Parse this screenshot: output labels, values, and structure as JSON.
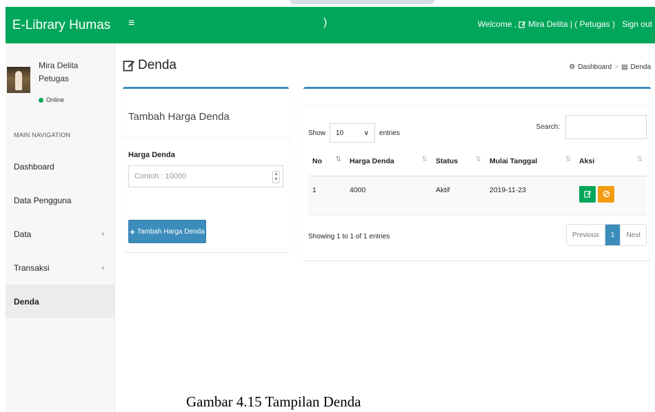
{
  "colors": {
    "header": "#00a65a",
    "primary": "#3c8dbc",
    "success": "#00a65a",
    "warning": "#f39c12"
  },
  "header": {
    "brand": "E-Library Humas",
    "menu_icon": "hamburger-icon",
    "spinner": ")",
    "welcome_prefix": "Welcome ,",
    "welcome_icon": "edit-icon",
    "welcome_text": "Mira Delita | ( Petugas )",
    "signout": "Sign out"
  },
  "sidebar": {
    "user": {
      "name": "Mira Delita",
      "role": "Petugas",
      "status": "Online"
    },
    "nav_header": "MAIN NAVIGATION",
    "items": [
      {
        "label": "Dashboard",
        "chevron": ""
      },
      {
        "label": "Data Pengguna",
        "chevron": ""
      },
      {
        "label": "Data",
        "chevron": "‹"
      },
      {
        "label": "Transaksi",
        "chevron": "‹"
      },
      {
        "label": "Denda",
        "chevron": "",
        "active": true
      }
    ]
  },
  "page": {
    "title": "Denda",
    "title_icon": "edit-icon",
    "breadcrumb": {
      "home": "Dashboard",
      "current": "Denda"
    }
  },
  "form": {
    "title": "Tambah Harga Denda",
    "field_label": "Harga Denda",
    "field_placeholder": "Contoh : 10000",
    "submit_label": "Tambah Harga Denda"
  },
  "table": {
    "show_label": "Show",
    "page_size": "10",
    "entries_label": "entries",
    "search_label": "Search:",
    "columns": [
      "No",
      "Harga Denda",
      "Status",
      "Mulai Tanggal",
      "Aksi"
    ],
    "rows": [
      {
        "no": "1",
        "harga": "4000",
        "status": "Aktif",
        "tanggal": "2019-11-23"
      }
    ],
    "info": "Showing 1 to 1 of 1 entries",
    "pagination": {
      "previous": "Previous",
      "current": "1",
      "next": "Next"
    }
  },
  "caption": "Gambar 4.15  Tampilan Denda"
}
